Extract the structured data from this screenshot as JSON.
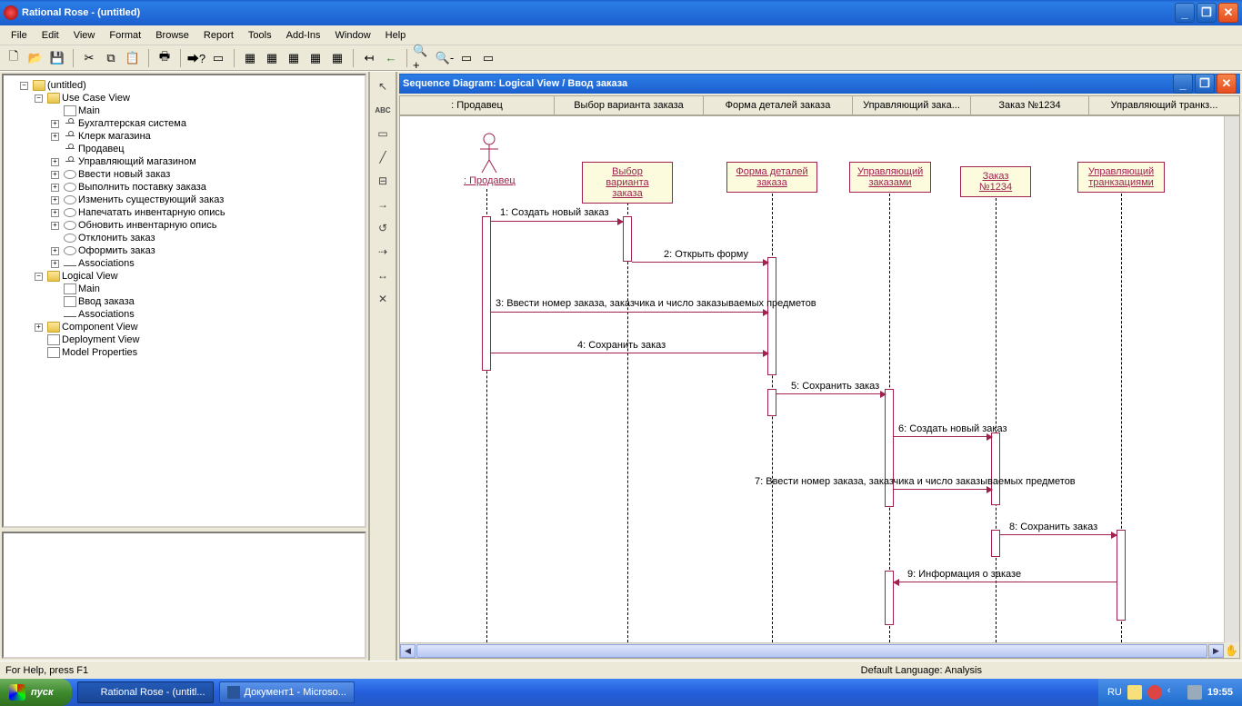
{
  "titlebar": {
    "text": "Rational Rose - (untitled)"
  },
  "menu": [
    "File",
    "Edit",
    "View",
    "Format",
    "Browse",
    "Report",
    "Tools",
    "Add-Ins",
    "Window",
    "Help"
  ],
  "tree": {
    "root": "(untitled)",
    "usecase": "Use Case View",
    "uc_main": "Main",
    "uc_a1": "Бухгалтерская система",
    "uc_a2": "Клерк магазина",
    "uc_a3": "Продавец",
    "uc_a4": "Управляющий магазином",
    "uc_c1": "Ввести новый заказ",
    "uc_c2": "Выполнить поставку заказа",
    "uc_c3": "Изменить существующий заказ",
    "uc_c4": "Напечатать инвентарную опись",
    "uc_c5": "Обновить инвентарную опись",
    "uc_c6": "Отклонить заказ",
    "uc_c7": "Оформить заказ",
    "uc_assoc": "Associations",
    "logical": "Logical View",
    "lv_main": "Main",
    "lv_seq": "Ввод заказа",
    "lv_assoc": "Associations",
    "component": "Component View",
    "deployment": "Deployment View",
    "modelprops": "Model Properties"
  },
  "diagram": {
    "title": "Sequence Diagram: Logical View / Ввод заказа",
    "headers": [
      ": Продавец",
      "Выбор варианта заказа",
      "Форма деталей заказа",
      "Управляющий зака...",
      "Заказ №1234",
      "Управляющий транкз..."
    ],
    "actor": ": Продавец",
    "objects": [
      "Выбор варианта заказа",
      "Форма деталей заказа",
      "Управляющий заказами",
      "Заказ №1234",
      "Управляющий транкзациями"
    ],
    "messages": [
      "1: Создать новый заказ",
      "2: Открыть форму",
      "3: Ввести номер заказа, заказчика и число заказываемых предметов",
      "4: Сохранить заказ",
      "5: Сохранить заказ",
      "6: Создать новый заказ",
      "7: Ввести номер заказа, заказчика и число заказываемых предметов",
      "8: Сохранить заказ",
      "9: Информация о заказе"
    ]
  },
  "status": {
    "help": "For Help, press F1",
    "lang": "Default Language: Analysis"
  },
  "taskbar": {
    "start": "пуск",
    "app1": "Rational Rose - (untitl...",
    "app2": "Документ1 - Microso...",
    "locale": "RU",
    "clock": "19:55"
  },
  "palette_abc": "ABC"
}
